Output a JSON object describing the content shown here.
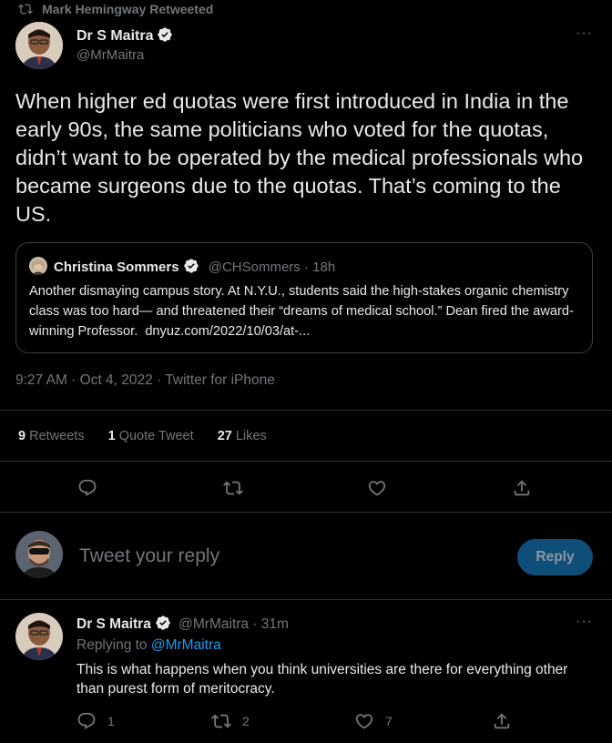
{
  "retweet_header": {
    "text": "Mark Hemingway Retweeted"
  },
  "tweet": {
    "author_name": "Dr S Maitra",
    "author_handle": "@MrMaitra",
    "more_label": "···",
    "body": "When higher ed quotas were first introduced in India in the early 90s, the same politicians who voted for the quotas, didn’t want to be operated by the medical professionals who became surgeons due to the quotas. That’s coming to the US.",
    "quote": {
      "author_name": "Christina Sommers",
      "author_handle": "@CHSommers",
      "time": "· 18h",
      "body": "Another dismaying campus story. At N.Y.U., students said the high-stakes organic chemistry class was too hard— and threatened their “dreams of medical school.” Dean fired the award-winning Professor.",
      "link": "dnyuz.com/2022/10/03/at-..."
    },
    "meta": "9:27 AM · Oct 4, 2022 · Twitter for iPhone",
    "stats": {
      "retweets_count": "9",
      "retweets_label": "Retweets",
      "quotes_count": "1",
      "quotes_label": "Quote Tweet",
      "likes_count": "27",
      "likes_label": "Likes"
    }
  },
  "reply_box": {
    "placeholder": "Tweet your reply",
    "button_label": "Reply"
  },
  "reply": {
    "author_name": "Dr S Maitra",
    "author_handle": "@MrMaitra",
    "time": "· 31m",
    "more_label": "···",
    "replying_to_label": "Replying to",
    "replying_to_handle": "@MrMaitra",
    "body": "This is what happens when you think universities are there for everything other than purest form of meritocracy.",
    "reply_count": "1",
    "retweet_count": "2",
    "like_count": "7"
  },
  "colors": {
    "background": "#000000",
    "text": "#e7e9ea",
    "muted": "#71767b",
    "accent": "#1d9bf0",
    "divider": "#2f3336",
    "reply_button_bg": "#0f4e78"
  }
}
